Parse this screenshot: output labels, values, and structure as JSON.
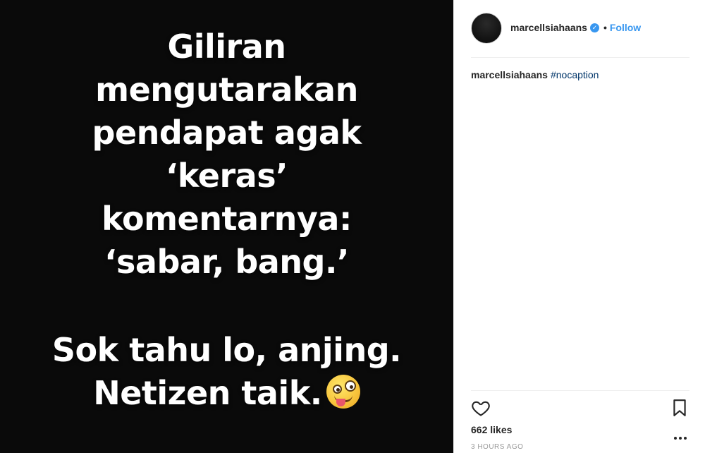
{
  "post": {
    "image_text": {
      "lines_top": [
        "Giliran",
        "mengutarakan",
        "pendapat agak",
        "‘keras’",
        "komentarnya:",
        "‘sabar, bang.’"
      ],
      "lines_bottom": [
        "Sok tahu lo, anjing.",
        "Netizen taik."
      ],
      "emoji": "crazy-face-emoji"
    },
    "header": {
      "username": "marcellsiahaans",
      "verified_icon": "verified-badge-icon",
      "separator": "•",
      "follow_label": "Follow"
    },
    "caption": {
      "username": "marcellsiahaans",
      "hashtag": "#nocaption"
    },
    "actions": {
      "like_icon": "heart-icon",
      "save_icon": "bookmark-icon",
      "more_icon": "more-options-icon"
    },
    "likes": "662 likes",
    "timestamp": "3 HOURS AGO"
  },
  "colors": {
    "image_background": "#0a0a0a",
    "accent": "#3897f0",
    "hashtag": "#003569",
    "text": "#262626",
    "muted": "#999999"
  }
}
